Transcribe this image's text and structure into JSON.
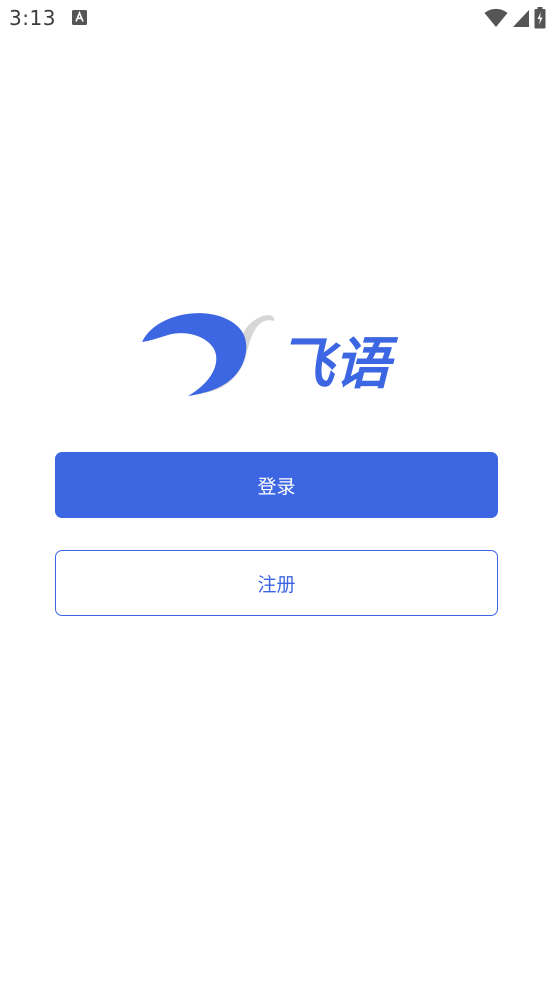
{
  "status_bar": {
    "time": "3:13",
    "app_icon": "a-notification-icon",
    "wifi_icon": "wifi-icon",
    "signal_icon": "signal-icon",
    "battery_icon": "battery-charging-icon"
  },
  "logo": {
    "text": "飞语",
    "icon": "bird-wing-logo-icon"
  },
  "actions": {
    "login_label": "登录",
    "register_label": "注册"
  },
  "colors": {
    "primary": "#3d66e3",
    "background": "#ffffff",
    "status_text": "#3c3c3c"
  }
}
